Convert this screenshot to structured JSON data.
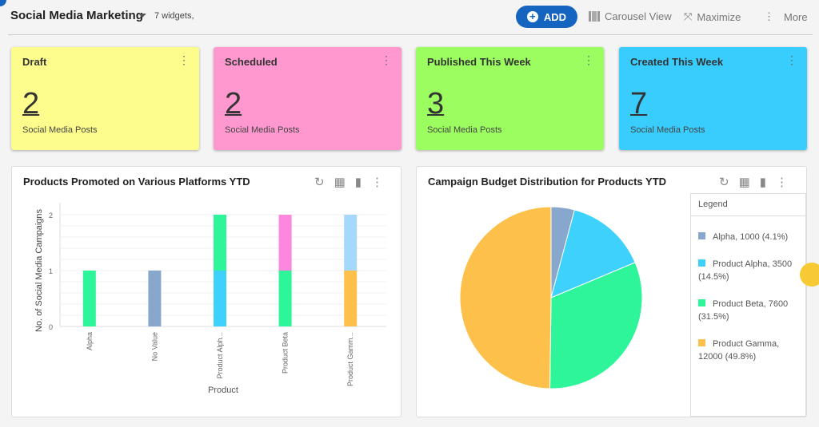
{
  "header": {
    "title": "Social Media Marketing",
    "widget_count": "7 widgets,",
    "add_label": "ADD",
    "carousel_label": "Carousel View",
    "maximize_label": "Maximize",
    "more_label": "More"
  },
  "cards": [
    {
      "title": "Draft",
      "value": "2",
      "subtitle": "Social Media Posts",
      "color": "#fdfd8d"
    },
    {
      "title": "Scheduled",
      "value": "2",
      "subtitle": "Social Media Posts",
      "color": "#fe98cf"
    },
    {
      "title": "Published This Week",
      "value": "3",
      "subtitle": "Social Media Posts",
      "color": "#9cfd60"
    },
    {
      "title": "Created This Week",
      "value": "7",
      "subtitle": "Social Media Posts",
      "color": "#39cdfd"
    }
  ],
  "chart_data": [
    {
      "type": "bar",
      "stacked": true,
      "title": "Products Promoted on Various Platforms YTD",
      "xlabel": "Product",
      "ylabel": "No. of Social Media Campaigns",
      "ylim": [
        0,
        2
      ],
      "yticks": [
        "0",
        "1",
        "2"
      ],
      "grid": true,
      "categories": [
        "Alpha",
        "No Value",
        "Product Alph...",
        "Product Beta",
        "Product Gamm..."
      ],
      "stacks": [
        [
          {
            "value": 1,
            "color": "#2ff59a"
          }
        ],
        [
          {
            "value": 1,
            "color": "#87a8cc"
          }
        ],
        [
          {
            "value": 1,
            "color": "#3dd1fc"
          },
          {
            "value": 1,
            "color": "#2ff59a"
          }
        ],
        [
          {
            "value": 1,
            "color": "#2ff59a"
          },
          {
            "value": 1,
            "color": "#fd87de"
          }
        ],
        [
          {
            "value": 1,
            "color": "#fdc04a"
          },
          {
            "value": 1,
            "color": "#a6d8fb"
          }
        ]
      ]
    },
    {
      "type": "pie",
      "title": "Campaign Budget Distribution for Products YTD",
      "legend_title": "Legend",
      "legend_position": "right",
      "slices": [
        {
          "label": "Alpha, 1000 (4.1%)",
          "value": 1000,
          "color": "#87a8cc"
        },
        {
          "label": "Product Alpha, 3500 (14.5%)",
          "value": 3500,
          "color": "#3dd1fc"
        },
        {
          "label": "Product Beta, 7600 (31.5%)",
          "value": 7600,
          "color": "#2ff59a"
        },
        {
          "label": "Product Gamma, 12000 (49.8%)",
          "value": 12000,
          "color": "#fdc04a"
        }
      ]
    }
  ]
}
